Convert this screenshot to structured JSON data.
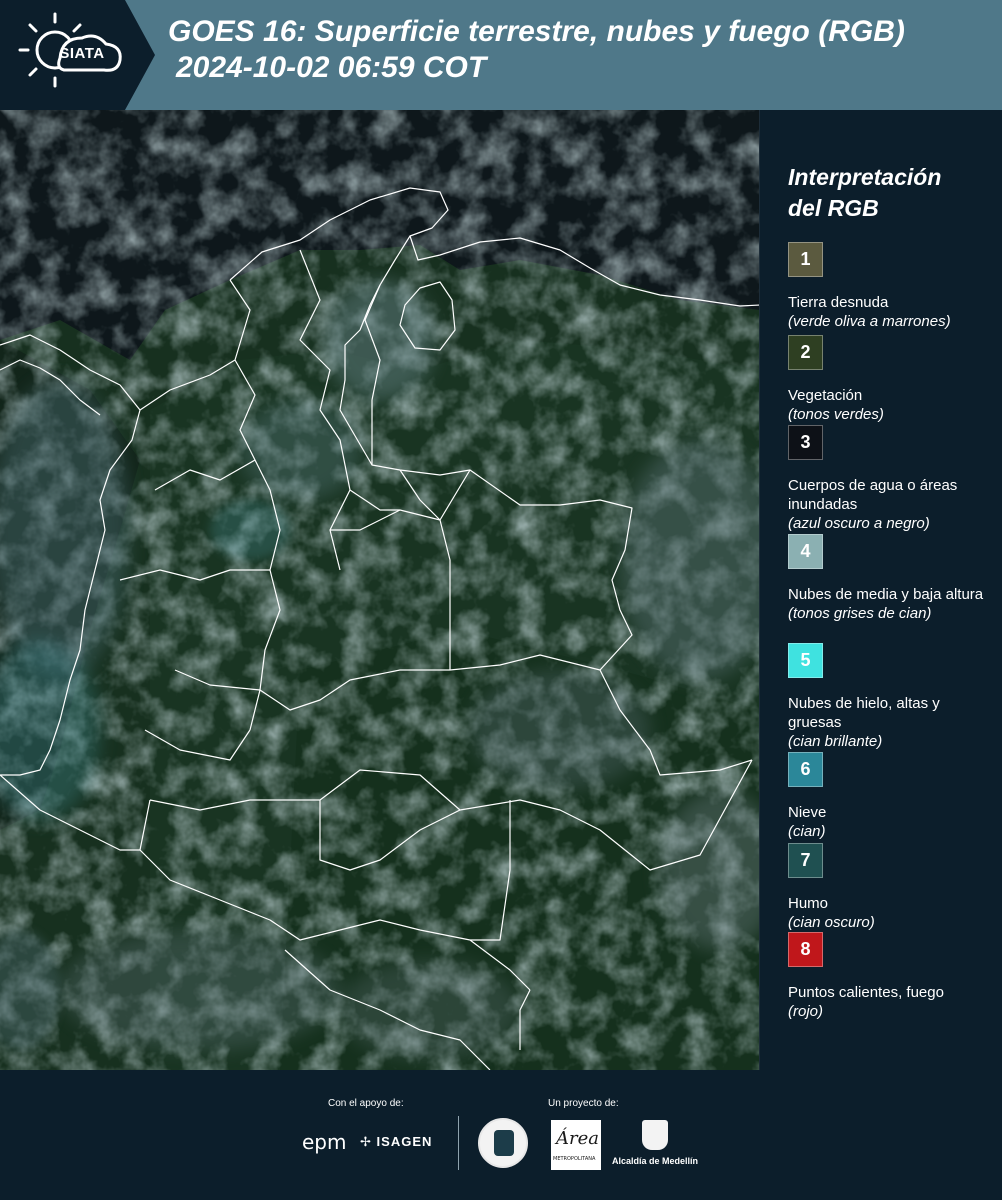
{
  "header": {
    "logo_text": "SIATA",
    "title_line1": "GOES 16: Superficie terrestre, nubes y fuego (RGB)",
    "title_line2": "2024-10-02 06:59 COT"
  },
  "map": {
    "description_colors": {
      "background": "#101c1e",
      "land": "#1b3322",
      "clouds": "#5c7377",
      "border_lines": "#ffffff"
    }
  },
  "legend": {
    "title_line1": "Interpretación",
    "title_line2": "del RGB",
    "items": [
      {
        "number": "1",
        "color": "#5b5a3f",
        "label": "Tierra desnuda",
        "sub": "(verde oliva a marrones)"
      },
      {
        "number": "2",
        "color": "#2e3f22",
        "label": "Vegetación",
        "sub": "(tonos verdes)"
      },
      {
        "number": "3",
        "color": "#0d1117",
        "label": "Cuerpos de agua o áreas inundadas",
        "sub": "(azul oscuro a negro)"
      },
      {
        "number": "4",
        "color": "#8bb0b2",
        "label": "Nubes de media y baja altura",
        "sub": "(tonos grises de cian)"
      },
      {
        "number": "5",
        "color": "#3fe2e0",
        "label": "Nubes de hielo, altas y gruesas",
        "sub": "(cian brillante)"
      },
      {
        "number": "6",
        "color": "#2b8799",
        "label": "Nieve",
        "sub": "(cian)"
      },
      {
        "number": "7",
        "color": "#1f5051",
        "label": "Humo",
        "sub": "(cian oscuro)"
      },
      {
        "number": "8",
        "color": "#c0171b",
        "label": "Puntos calientes, fuego",
        "sub": "(rojo)"
      }
    ]
  },
  "footer": {
    "support_label": "Con el apoyo de:",
    "project_label": "Un proyecto de:",
    "epm": "epm",
    "isagen": "ISAGEN",
    "amva_script": "Área",
    "amva_small": "METROPOLITANA",
    "medellin": "Alcaldía de Medellín"
  }
}
